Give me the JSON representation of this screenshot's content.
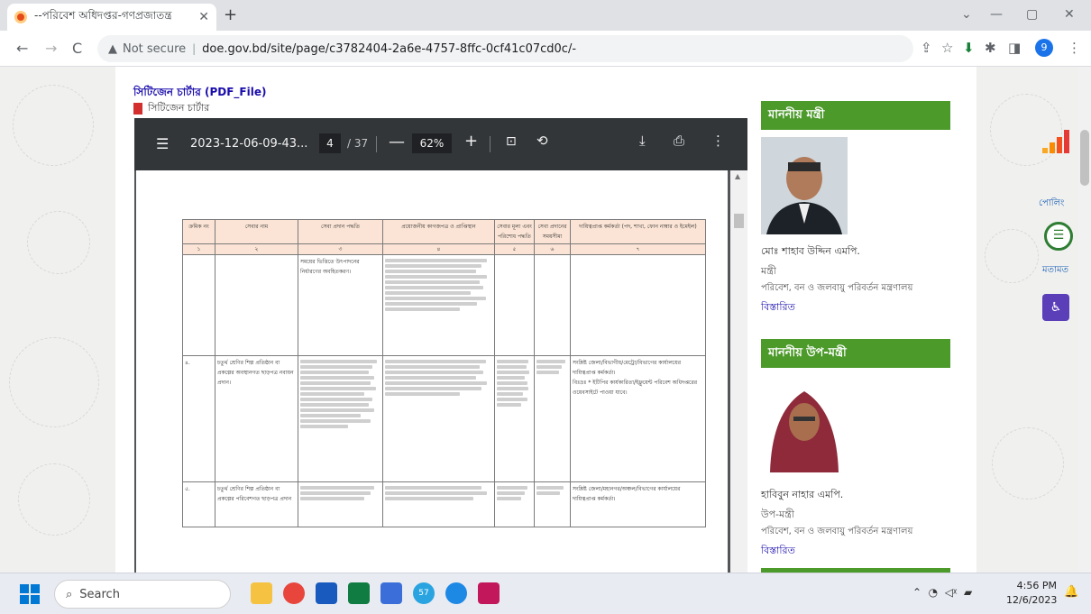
{
  "browser": {
    "tab_title": "--পরিবেশ অধিদপ্তর-গণপ্রজাতন্ত্র",
    "new_tab": "+",
    "window_controls": {
      "dropdown": "⌄",
      "minimize": "—",
      "maximize": "▢",
      "close": "✕"
    },
    "nav": {
      "back": "←",
      "forward": "→",
      "reload": "C"
    },
    "security_label": "Not secure",
    "url": "doe.gov.bd/site/page/c3782404-2a6e-4757-8ffc-0cf41c07cd0c/-",
    "profile_initial": "9"
  },
  "page": {
    "section_title": "সিটিজেন চার্টার (PDF_File)",
    "file_link": "সিটিজেন চার্টার"
  },
  "pdf": {
    "filename": "2023-12-06-09-43...",
    "current_page": "4",
    "total_pages": "/ 37",
    "zoom": "62%",
    "table": {
      "headers": [
        "ক্রমিক নং",
        "সেবার নাম",
        "সেবা প্রদান পদ্ধতি",
        "প্রয়োজনীয় কাগজপত্র ও প্রাপ্তিস্থান",
        "সেবার মূল্য এবং পরিশোধ পদ্ধতি",
        "সেবা প্রদানের সময়সীমা",
        "দায়িত্বপ্রাপ্ত কর্মকর্তা (পদ, শাখা, ফোন নাম্বার ও ইমেইল)"
      ],
      "col_numbers": [
        "১",
        "২",
        "৩",
        "৪",
        "৫",
        "৬",
        "৭"
      ],
      "row1": {
        "service_method": "সময়ের ভিত্তিতে উৎপাদনের নির্ধারণের অবহিতকরণ।"
      },
      "row2": {
        "serial": "৪.",
        "service_name": "চতুর্থ শ্রেণির শিল্প প্রতিষ্ঠান বা প্রকল্পের অবস্থানগত ছাড়পত্র নবায়ন প্রদান।",
        "official": "সংশ্লিষ্ট জেলা/বিভাগীয়/মেট্রো/বিভাগের কার্যালয়ের দায়িত্বপ্রাপ্ত কর্মকর্তা।",
        "note": "বিঃদ্রঃ * ইটিপির কার্যকারিতা/ইফ্লুয়েন্ট পরিবেশ অধিদপ্তরের ওয়েবসাইটে পাওয়া যাবে।"
      },
      "row3": {
        "serial": "৫.",
        "service_name": "চতুর্থ শ্রেণির শিল্প প্রতিষ্ঠান বা প্রকল্পের পরিবেশগত ছাড়পত্র প্রদান",
        "official": "সংশ্লিষ্ট জেলা/মহানগর/অঞ্চল/বিভাগের কার্যালয়ের দায়িত্বপ্রাপ্ত কর্মকর্তা।"
      }
    }
  },
  "sidebar": {
    "minister": {
      "heading": "মাননীয় মন্ত্রী",
      "name": "মোঃ শাহাব উদ্দিন এমপি.",
      "designation": "মন্ত্রী",
      "ministry": "পরিবেশ, বন ও জলবায়ু পরিবর্তন মন্ত্রণালয়",
      "details": "বিস্তারিত"
    },
    "deputy_minister": {
      "heading": "মাননীয় উপ-মন্ত্রী",
      "name": "হাবিবুন নাহার এমপি.",
      "designation": "উপ-মন্ত্রী",
      "ministry": "পরিবেশ, বন ও জলবায়ু পরিবর্তন মন্ত্রণালয়",
      "details": "বিস্তারিত"
    }
  },
  "floating": {
    "policy": "পোলিং",
    "opinion": "মতামত"
  },
  "taskbar": {
    "search_label": "Search",
    "time": "4:56 PM",
    "date": "12/6/2023",
    "badge": "57"
  },
  "colors": {
    "accent_green": "#4c9a2a",
    "pdf_toolbar": "#323639",
    "table_header": "#fbe4d5"
  }
}
